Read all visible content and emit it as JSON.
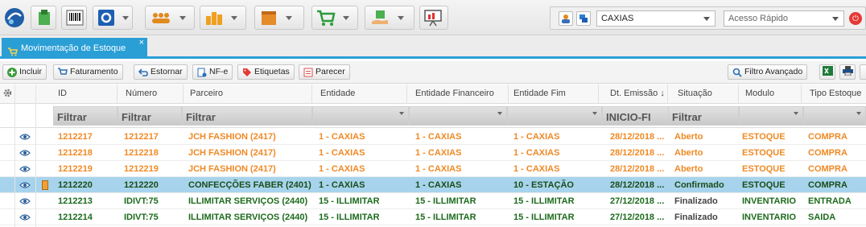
{
  "toolbar": {
    "buttons": [
      {
        "icon": "box-upload-icon",
        "color": "#2a8f3a"
      },
      {
        "icon": "barcode-icon",
        "color": "#444444"
      },
      {
        "icon": "settings-box-icon",
        "color": "#1e5fb3"
      },
      {
        "icon": "people-icon",
        "color": "#e08a1e"
      },
      {
        "icon": "bar-chart-icon",
        "color": "#f0a020"
      },
      {
        "icon": "package-icon",
        "color": "#e58b2a"
      },
      {
        "icon": "cart-icon",
        "color": "#2a9b3a"
      },
      {
        "icon": "hand-box-icon",
        "color": "#3aa04a"
      },
      {
        "icon": "presentation-icon",
        "color": "#555555"
      }
    ]
  },
  "header_right": {
    "company_value": "CAXIAS",
    "quick_access_value": "Acesso Rápido"
  },
  "tab": {
    "label": "Movimentação de Estoque",
    "close": "×"
  },
  "actions": {
    "incluir": "Incluir",
    "faturamento": "Faturamento",
    "estornar": "Estornar",
    "nfe": "NF-e",
    "etiquetas": "Etiquetas",
    "parecer": "Parecer",
    "filtro_avancado": "Filtro Avançado"
  },
  "grid": {
    "columns": [
      "ID",
      "Número",
      "Parceiro",
      "Entidade",
      "Entidade Financeiro",
      "Entidade Fim",
      "Dt. Emissão ↓",
      "Situação",
      "Modulo",
      "Tipo Estoque"
    ],
    "filters": [
      "Filtrar",
      "Filtrar",
      "Filtrar",
      "",
      "",
      "",
      "INICIO-FI",
      "Filtrar",
      "",
      ""
    ],
    "rows": [
      {
        "id": "1212217",
        "numero": "1212217",
        "parceiro": "JCH FASHION (2417)",
        "entidade": "1 - CAXIAS",
        "ent_fin": "1 - CAXIAS",
        "ent_fim": "1 - CAXIAS",
        "emissao": "28/12/2018 ...",
        "situacao": "Aberto",
        "modulo": "ESTOQUE",
        "tipo": "COMPRA",
        "status": "aberto"
      },
      {
        "id": "1212218",
        "numero": "1212218",
        "parceiro": "JCH FASHION (2417)",
        "entidade": "1 - CAXIAS",
        "ent_fin": "1 - CAXIAS",
        "ent_fim": "1 - CAXIAS",
        "emissao": "28/12/2018 ...",
        "situacao": "Aberto",
        "modulo": "ESTOQUE",
        "tipo": "COMPRA",
        "status": "aberto"
      },
      {
        "id": "1212219",
        "numero": "1212219",
        "parceiro": "JCH FASHION (2417)",
        "entidade": "1 - CAXIAS",
        "ent_fin": "1 - CAXIAS",
        "ent_fim": "1 - CAXIAS",
        "emissao": "28/12/2018 ...",
        "situacao": "Aberto",
        "modulo": "ESTOQUE",
        "tipo": "COMPRA",
        "status": "aberto"
      },
      {
        "id": "1212220",
        "numero": "1212220",
        "parceiro": "CONFECÇÕES FABER (2401)",
        "entidade": "1 - CAXIAS",
        "ent_fin": "1 - CAXIAS",
        "ent_fim": "10 - ESTAÇÃO",
        "emissao": "28/12/2018 ...",
        "situacao": "Confirmado",
        "modulo": "ESTOQUE",
        "tipo": "COMPRA",
        "status": "sel"
      },
      {
        "id": "1212213",
        "numero": "IDIVT:75",
        "parceiro": "ILLIMITAR SERVIÇOS (2440)",
        "entidade": "15 - ILLIMITAR",
        "ent_fin": "15 - ILLIMITAR",
        "ent_fim": "15 - ILLIMITAR",
        "emissao": "27/12/2018 ...",
        "situacao": "Finalizado",
        "modulo": "INVENTARIO",
        "tipo": "ENTRADA",
        "status": "fin"
      },
      {
        "id": "1212214",
        "numero": "IDIVT:75",
        "parceiro": "ILLIMITAR SERVIÇOS (2440)",
        "entidade": "15 - ILLIMITAR",
        "ent_fin": "15 - ILLIMITAR",
        "ent_fim": "15 - ILLIMITAR",
        "emissao": "27/12/2018 ...",
        "situacao": "Finalizado",
        "modulo": "INVENTARIO",
        "tipo": "SAIDA",
        "status": "fin"
      }
    ]
  }
}
